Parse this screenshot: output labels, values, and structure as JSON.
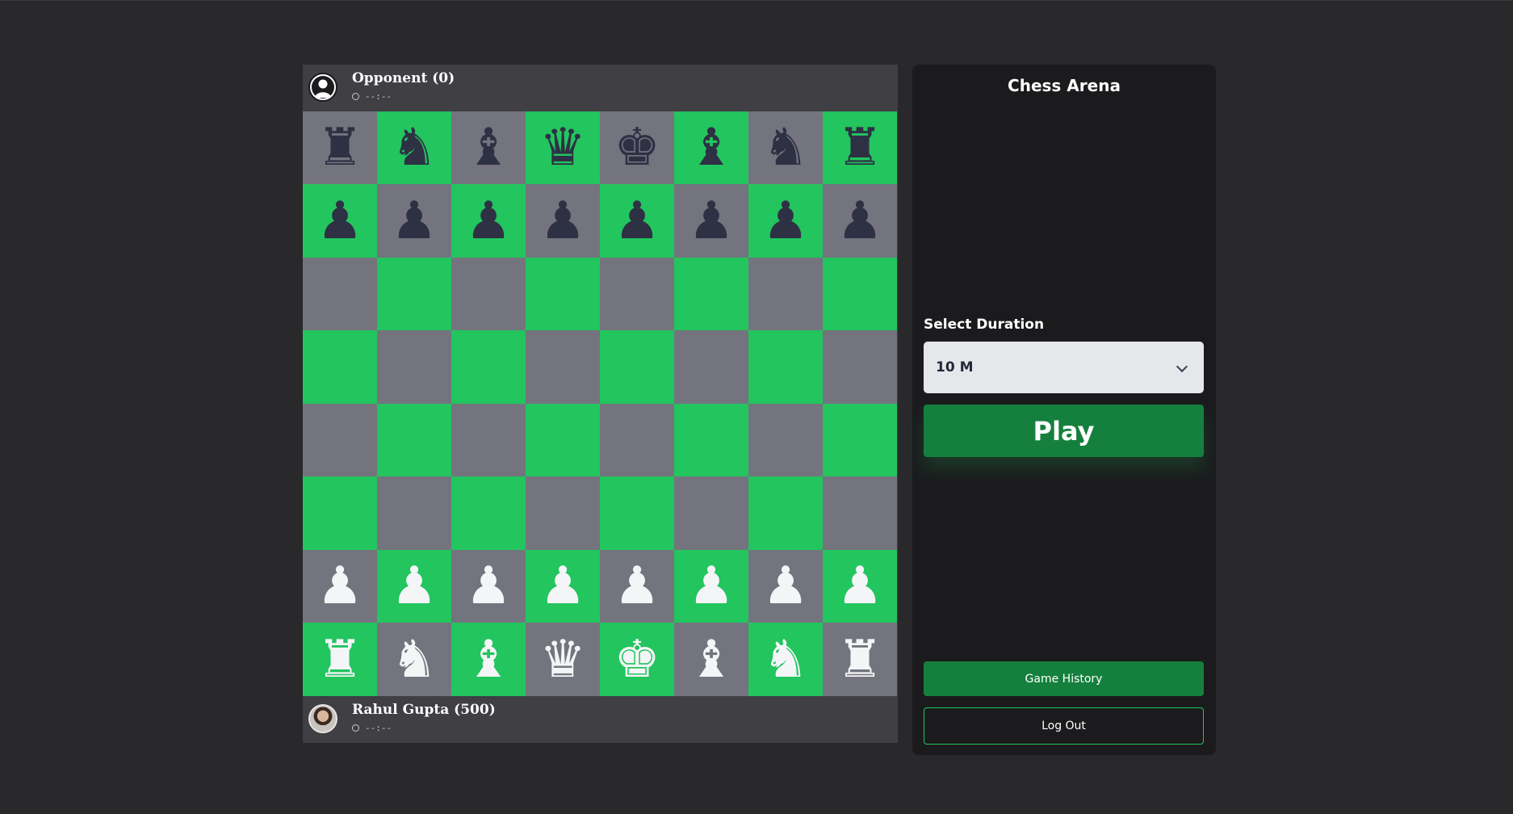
{
  "colors": {
    "page_bg": "#29292b",
    "light_square": "#74747e",
    "dark_square": "#22c55e",
    "black_piece": "#2e3044",
    "white_piece": "#f4f5f7",
    "accent_green": "#15803d"
  },
  "opponent": {
    "name": "Opponent (0)",
    "timer": "--:--",
    "avatar_icon": "user-silhouette-icon",
    "timer_icon": "clock-icon"
  },
  "player": {
    "name": "Rahul Gupta (500)",
    "timer": "--:--",
    "avatar_icon": "user-photo",
    "timer_icon": "clock-icon"
  },
  "board": {
    "ranks": [
      [
        "r",
        "n",
        "b",
        "q",
        "k",
        "b",
        "n",
        "r"
      ],
      [
        "p",
        "p",
        "p",
        "p",
        "p",
        "p",
        "p",
        "p"
      ],
      [
        "",
        "",
        "",
        "",
        "",
        "",
        "",
        ""
      ],
      [
        "",
        "",
        "",
        "",
        "",
        "",
        "",
        ""
      ],
      [
        "",
        "",
        "",
        "",
        "",
        "",
        "",
        ""
      ],
      [
        "",
        "",
        "",
        "",
        "",
        "",
        "",
        ""
      ],
      [
        "P",
        "P",
        "P",
        "P",
        "P",
        "P",
        "P",
        "P"
      ],
      [
        "R",
        "N",
        "B",
        "Q",
        "K",
        "B",
        "N",
        "R"
      ]
    ]
  },
  "panel": {
    "title": "Chess Arena",
    "duration_label": "Select Duration",
    "duration_value": "10 M",
    "play_label": "Play",
    "history_label": "Game History",
    "logout_label": "Log Out"
  }
}
